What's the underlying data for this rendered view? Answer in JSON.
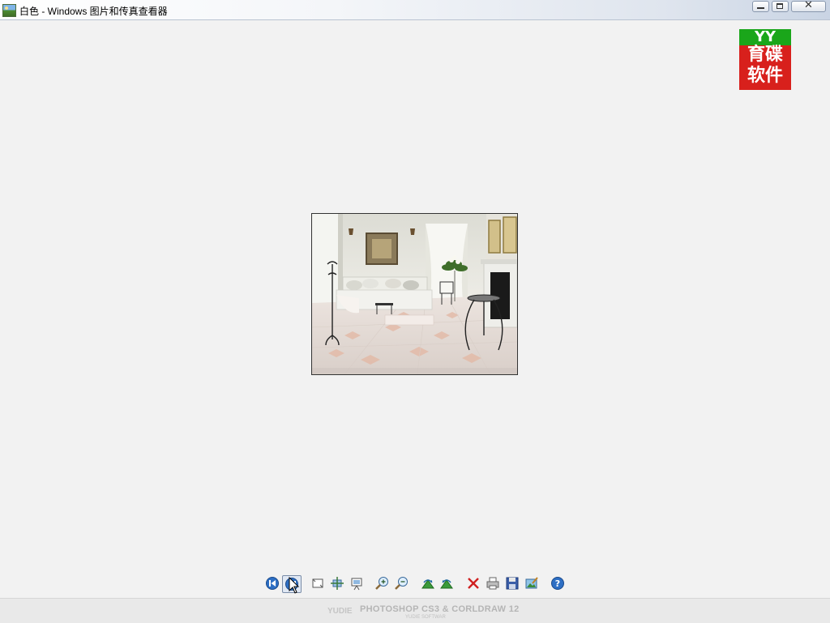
{
  "window": {
    "title": "白色 - Windows 图片和传真查看器",
    "icon": "image-viewer-app-icon",
    "controls": {
      "minimize": "minimize-icon",
      "maximize": "restore-icon",
      "close": "close-icon"
    },
    "close_glyph": "✕"
  },
  "logo": {
    "top_text": "YY",
    "line1": "育碟",
    "line2": "软件",
    "colors": {
      "background": "#d8201c",
      "accent": "#1aa61a"
    }
  },
  "image": {
    "description_icon": "photo-living-room"
  },
  "toolbar": {
    "buttons": [
      {
        "name": "previous-image-button",
        "icon": "previous-icon",
        "tooltip": ""
      },
      {
        "name": "next-image-button",
        "icon": "next-icon",
        "active": true
      },
      {
        "name": "best-fit-button",
        "icon": "best-fit-icon"
      },
      {
        "name": "actual-size-button",
        "icon": "actual-size-icon"
      },
      {
        "name": "slideshow-button",
        "icon": "slideshow-icon"
      },
      {
        "name": "zoom-in-button",
        "icon": "zoom-in-icon"
      },
      {
        "name": "zoom-out-button",
        "icon": "zoom-out-icon"
      },
      {
        "name": "rotate-clockwise-button",
        "icon": "rotate-clockwise-icon"
      },
      {
        "name": "rotate-counterclockwise-button",
        "icon": "rotate-counterclockwise-icon"
      },
      {
        "name": "delete-button",
        "icon": "delete-icon"
      },
      {
        "name": "print-button",
        "icon": "print-icon"
      },
      {
        "name": "save-button",
        "icon": "save-icon"
      },
      {
        "name": "open-for-editing-button",
        "icon": "edit-icon"
      },
      {
        "name": "help-button",
        "icon": "help-icon"
      }
    ]
  },
  "watermark": {
    "text": "PHOTOSHOP CS3 & CORLDRAW 12",
    "sub": "YUDIE SOFTWAR",
    "mark": "YUDIE"
  }
}
